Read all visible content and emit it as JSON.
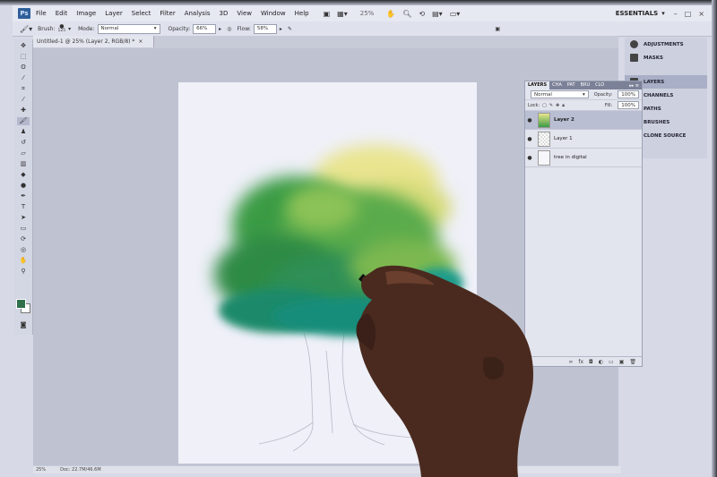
{
  "menubar": {
    "logo": "Ps",
    "items": [
      "File",
      "Edit",
      "Image",
      "Layer",
      "Select",
      "Filter",
      "Analysis",
      "3D",
      "View",
      "Window",
      "Help"
    ],
    "zoom": "25%",
    "workspace": "ESSENTIALS",
    "window_controls": [
      "–",
      "□",
      "×"
    ]
  },
  "options": {
    "brush_label": "Brush:",
    "brush_size": "125",
    "mode_label": "Mode:",
    "mode_value": "Normal",
    "opacity_label": "Opacity:",
    "opacity_value": "66%",
    "flow_label": "Flow:",
    "flow_value": "58%"
  },
  "document": {
    "tab_title": "Untitled-1 @ 25% (Layer 2, RGB/8) *",
    "status_zoom": "25%",
    "status_doc": "Doc: 22.7M/46.6M"
  },
  "dock": {
    "items": [
      {
        "label": "ADJUSTMENTS",
        "icon": "adjustments-icon"
      },
      {
        "label": "MASKS",
        "icon": "masks-icon"
      },
      {
        "label": "LAYERS",
        "icon": "layers-icon"
      },
      {
        "label": "CHANNELS",
        "icon": "channels-icon"
      },
      {
        "label": "PATHS",
        "icon": "paths-icon"
      },
      {
        "label": "BRUSHES",
        "icon": "brushes-icon"
      },
      {
        "label": "CLONE SOURCE",
        "icon": "clone-source-icon"
      }
    ]
  },
  "layers_panel": {
    "tabs": [
      "LAYERS",
      "CHA",
      "PAT",
      "BRU",
      "CLO"
    ],
    "blend_mode": "Normal",
    "opacity_label": "Opacity:",
    "opacity_value": "100%",
    "lock_label": "Lock:",
    "fill_label": "Fill:",
    "fill_value": "100%",
    "layers": [
      "Layer 2",
      "Layer 1",
      "tree in digital"
    ]
  },
  "colors": {
    "foreground": "#2f6f4a",
    "background": "#ffffff",
    "accent": "#2f5f9a"
  }
}
